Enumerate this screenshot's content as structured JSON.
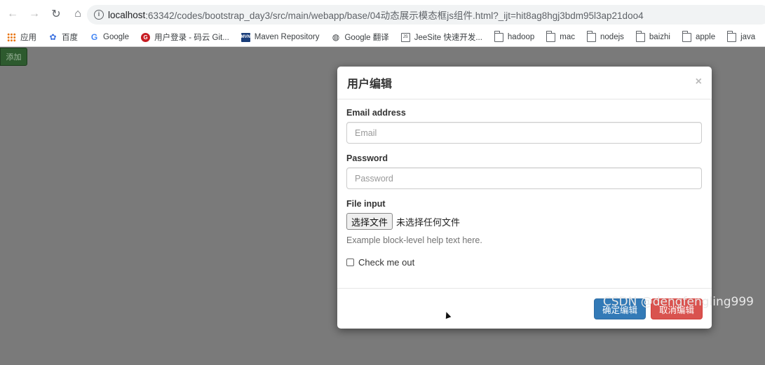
{
  "browser": {
    "nav": {
      "back_icon": "←",
      "forward_icon": "→",
      "reload_icon": "↻",
      "home_icon": "⌂"
    },
    "address_bar": {
      "host": "localhost",
      "rest": ":63342/codes/bootstrap_day3/src/main/webapp/base/04动态展示模态框js组件.html?_ijt=hit8ag8hgj3bdm95l3ap21doo4"
    },
    "bookmarks": [
      {
        "label": "应用",
        "icon": "apps-grid-icon"
      },
      {
        "label": "百度",
        "icon": "baidu-paw-icon"
      },
      {
        "label": "Google",
        "icon": "google-g-icon"
      },
      {
        "label": "用户登录 - 码云 Git...",
        "icon": "gitee-icon"
      },
      {
        "label": "Maven Repository",
        "icon": "maven-icon"
      },
      {
        "label": "Google 翻译",
        "icon": "globe-icon"
      },
      {
        "label": "JeeSite 快速开发...",
        "icon": "js-icon"
      },
      {
        "label": "hadoop",
        "icon": "folder-icon"
      },
      {
        "label": "mac",
        "icon": "folder-icon"
      },
      {
        "label": "nodejs",
        "icon": "folder-icon"
      },
      {
        "label": "baizhi",
        "icon": "folder-icon"
      },
      {
        "label": "apple",
        "icon": "folder-icon"
      },
      {
        "label": "java",
        "icon": "folder-icon"
      }
    ]
  },
  "page": {
    "add_button_label": "添加"
  },
  "modal": {
    "title": "用户编辑",
    "close_symbol": "×",
    "email": {
      "label": "Email address",
      "placeholder": "Email"
    },
    "password": {
      "label": "Password",
      "placeholder": "Password"
    },
    "file": {
      "label": "File input",
      "button_label": "选择文件",
      "status": "未选择任何文件",
      "help": "Example block-level help text here."
    },
    "checkbox_label": "Check me out",
    "confirm_label": "确定编辑",
    "cancel_label": "取消编辑"
  },
  "watermark": "CSDN @dengfengling999",
  "colors": {
    "primary": "#337ab7",
    "danger": "#d9534f",
    "overlay": "#7a7a7a",
    "add_button": "#2d5a2e"
  }
}
